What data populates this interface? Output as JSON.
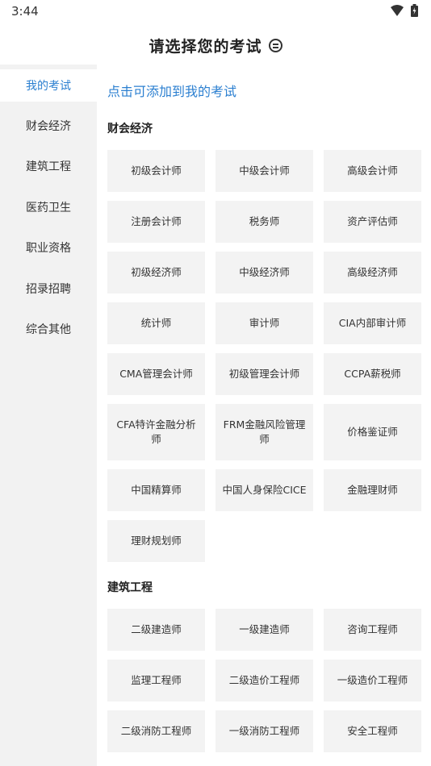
{
  "status_bar": {
    "time": "3:44"
  },
  "header": {
    "title": "请选择您的考试"
  },
  "sidebar": {
    "items": [
      {
        "label": "我的考试",
        "active": true
      },
      {
        "label": "财会经济"
      },
      {
        "label": "建筑工程"
      },
      {
        "label": "医药卫生"
      },
      {
        "label": "职业资格"
      },
      {
        "label": "招录招聘"
      },
      {
        "label": "综合其他"
      }
    ]
  },
  "content": {
    "hint": "点击可添加到我的考试",
    "sections": [
      {
        "title": "财会经济",
        "items": [
          "初级会计师",
          "中级会计师",
          "高级会计师",
          "注册会计师",
          "税务师",
          "资产评估师",
          "初级经济师",
          "中级经济师",
          "高级经济师",
          "统计师",
          "审计师",
          "CIA内部审计师",
          "CMA管理会计师",
          "初级管理会计师",
          "CCPA薪税师",
          "CFA特许金融分析师",
          "FRM金融风险管理师",
          "价格鉴证师",
          "中国精算师",
          "中国人身保险CICE",
          "金融理财师",
          "理财规划师"
        ]
      },
      {
        "title": "建筑工程",
        "items": [
          "二级建造师",
          "一级建造师",
          "咨询工程师",
          "监理工程师",
          "二级造价工程师",
          "一级造价工程师",
          "二级消防工程师",
          "一级消防工程师",
          "安全工程师"
        ]
      }
    ]
  },
  "colors": {
    "accent": "#2b7fd0",
    "sidebar_bg": "#f2f2f2",
    "tile_bg": "#f3f3f3"
  }
}
